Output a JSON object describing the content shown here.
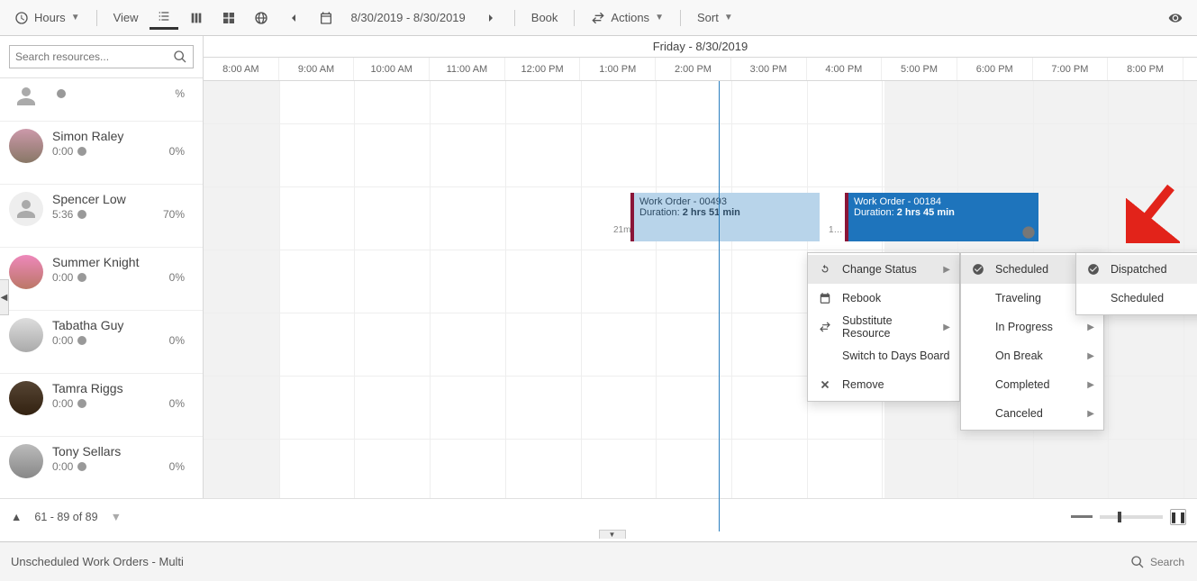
{
  "toolbar": {
    "hours_label": "Hours",
    "view_label": "View",
    "date_range": "8/30/2019 - 8/30/2019",
    "book_label": "Book",
    "actions_label": "Actions",
    "sort_label": "Sort"
  },
  "search": {
    "placeholder": "Search resources..."
  },
  "day_header": "Friday - 8/30/2019",
  "hours": [
    "8:00 AM",
    "9:00 AM",
    "10:00 AM",
    "11:00 AM",
    "12:00 PM",
    "1:00 PM",
    "2:00 PM",
    "3:00 PM",
    "4:00 PM",
    "5:00 PM",
    "6:00 PM",
    "7:00 PM",
    "8:00 PM"
  ],
  "resources": [
    {
      "name": "",
      "time": "",
      "pct": "%"
    },
    {
      "name": "Simon Raley",
      "time": "0:00",
      "pct": "0%"
    },
    {
      "name": "Spencer Low",
      "time": "5:36",
      "pct": "70%"
    },
    {
      "name": "Summer Knight",
      "time": "0:00",
      "pct": "0%"
    },
    {
      "name": "Tabatha Guy",
      "time": "0:00",
      "pct": "0%"
    },
    {
      "name": "Tamra Riggs",
      "time": "0:00",
      "pct": "0%"
    },
    {
      "name": "Tony Sellars",
      "time": "0:00",
      "pct": "0%"
    }
  ],
  "bookings": {
    "b1": {
      "title": "Work Order - 00493",
      "dur_label": "Duration: ",
      "dur_value": "2 hrs 51 min",
      "travel": "21m"
    },
    "b2": {
      "title": "Work Order - 00184",
      "dur_label": "Duration: ",
      "dur_value": "2 hrs 45 min",
      "travel": "1…"
    }
  },
  "menu1": {
    "change_status": "Change Status",
    "rebook": "Rebook",
    "substitute": "Substitute Resource",
    "switch_board": "Switch to Days Board",
    "remove": "Remove"
  },
  "menu2": {
    "scheduled": "Scheduled",
    "traveling": "Traveling",
    "in_progress": "In Progress",
    "on_break": "On Break",
    "completed": "Completed",
    "canceled": "Canceled"
  },
  "menu3": {
    "dispatched": "Dispatched",
    "scheduled": "Scheduled"
  },
  "footer": {
    "range": "61 - 89 of 89"
  },
  "bottom": {
    "title": "Unscheduled Work Orders - Multi",
    "search_placeholder": "Search"
  }
}
